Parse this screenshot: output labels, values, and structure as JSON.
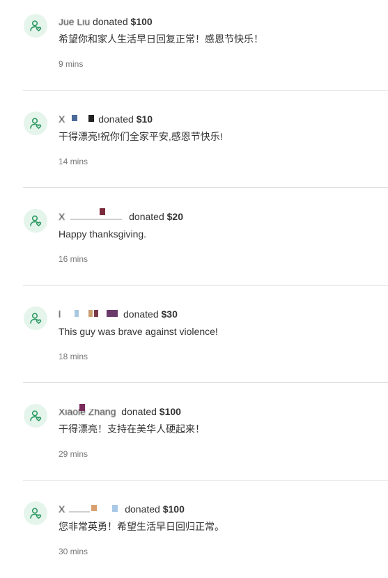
{
  "donations": [
    {
      "donor": "Jue Liu",
      "verb": "donated",
      "amount": "$100",
      "message": "希望你和家人生活早日回复正常！感恩节快乐！",
      "time": "9 mins"
    },
    {
      "donor": "X",
      "verb": "donated",
      "amount": "$10",
      "message": "干得漂亮!祝你们全家平安,感恩节快乐!",
      "time": "14 mins"
    },
    {
      "donor": "X",
      "verb": "donated",
      "amount": "$20",
      "message": "Happy thanksgiving.",
      "time": "16 mins"
    },
    {
      "donor": "l",
      "verb": "donated",
      "amount": "$30",
      "message": "This guy was brave against violence!",
      "time": "18 mins"
    },
    {
      "donor": "Xiaole Zhang",
      "verb": "donated",
      "amount": "$100",
      "message": "干得漂亮！支持在美华人硬起来！",
      "time": "29 mins"
    },
    {
      "donor": "X",
      "verb": "donated",
      "amount": "$100",
      "message": "您非常英勇！希望生活早日回归正常。",
      "time": "30 mins"
    }
  ],
  "colors": {
    "avatar_bg": "#e5f5ec",
    "avatar_icon": "#2f9a63",
    "text": "#333333",
    "time": "#767676",
    "divider": "#dcdcdc"
  }
}
